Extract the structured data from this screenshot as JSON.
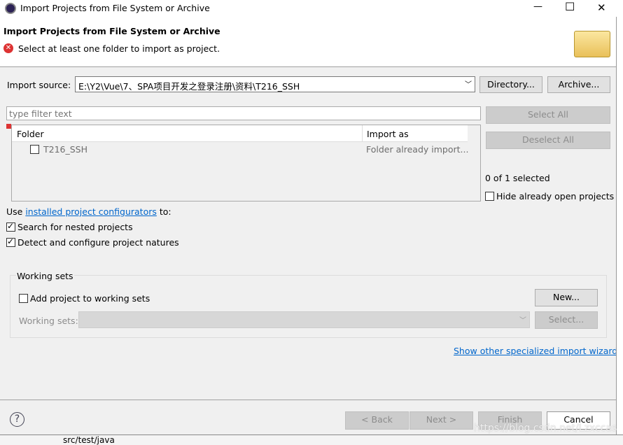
{
  "window": {
    "title": "Import Projects from File System or Archive",
    "minimize": "—",
    "maximize": "☐",
    "close": "✕"
  },
  "header": {
    "title": "Import Projects from File System or Archive",
    "message": "Select at least one folder to import as project."
  },
  "source": {
    "label": "Import source:",
    "value": "E:\\Y2\\Vue\\7、SPA项目开发之登录注册\\资料\\T216_SSH",
    "directory": "Directory...",
    "archive": "Archive..."
  },
  "filter": {
    "placeholder": "type filter text"
  },
  "table": {
    "columns": [
      "Folder",
      "Import as"
    ],
    "rows": [
      {
        "folder": "T216_SSH",
        "import_as": "Folder already import...",
        "checked": false
      }
    ]
  },
  "side": {
    "select_all": "Select All",
    "deselect_all": "Deselect All",
    "count": "0 of 1 selected",
    "hide_open": "Hide already open projects"
  },
  "configurators": {
    "prefix": "Use ",
    "link": "installed project configurators",
    "suffix": " to:"
  },
  "options": {
    "nested": "Search for nested projects",
    "natures": "Detect and configure project natures"
  },
  "working_sets": {
    "title": "Working sets",
    "add": "Add project to working sets",
    "new": "New...",
    "label": "Working sets:",
    "select": "Select..."
  },
  "wizards_link": "Show other specialized import wizards",
  "footer": {
    "help": "?",
    "back": "< Back",
    "next": "Next >",
    "finish": "Finish",
    "cancel": "Cancel"
  },
  "background": {
    "tree_item": "src/test/java",
    "watermark": "https://blog.csdn.net/Lzxccas"
  }
}
